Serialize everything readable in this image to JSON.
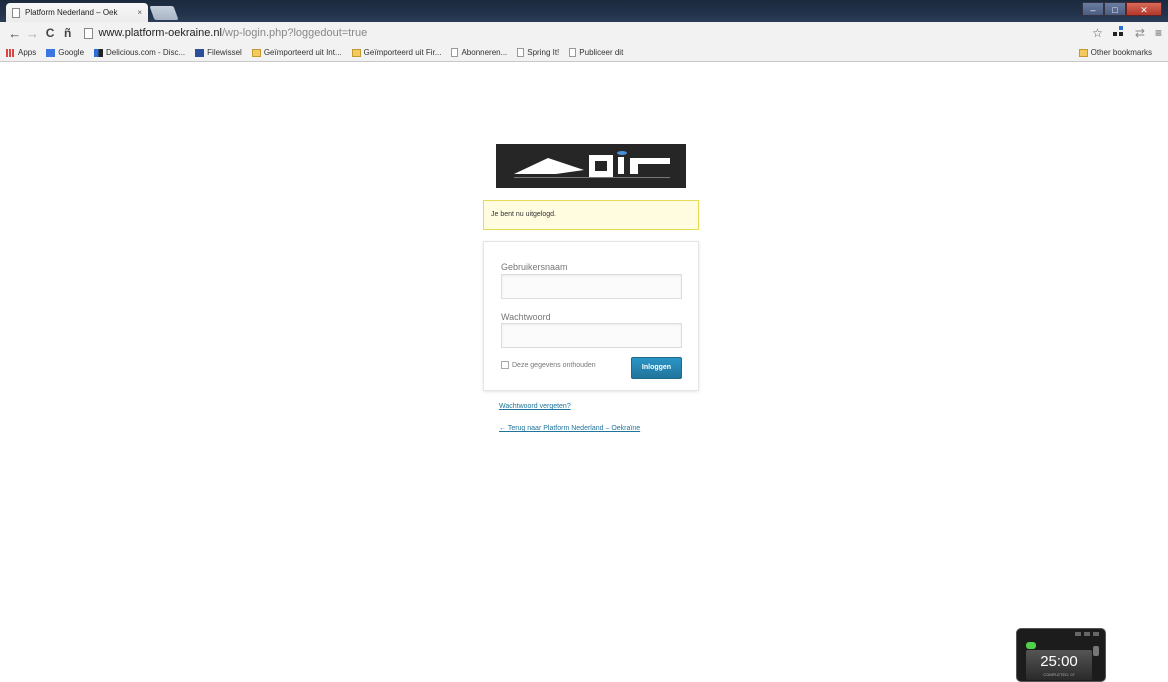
{
  "browser": {
    "tab_title": "Platform Nederland – Oek",
    "tab_close": "×",
    "url_host": "www.platform-oekraine.nl",
    "url_path": "/wp-login.php?loggedout=true",
    "nav": {
      "back": "←",
      "forward": "→",
      "reload": "C",
      "home": "ñ"
    },
    "toolbar_right": {
      "star": "☆",
      "menu": "≡"
    },
    "bookmarks": [
      {
        "label": "Apps",
        "icon": "apps-icon"
      },
      {
        "label": "Google",
        "icon": "google-icon"
      },
      {
        "label": "Delicious.com - Disc...",
        "icon": "delicious-icon"
      },
      {
        "label": "Filewissel",
        "icon": "filewissel-icon"
      },
      {
        "label": "Geïmporteerd uit Int...",
        "icon": "folder-icon"
      },
      {
        "label": "Geïmporteerd uit Fir...",
        "icon": "folder-icon"
      },
      {
        "label": "Abonneren...",
        "icon": "page-icon"
      },
      {
        "label": "Spring It!",
        "icon": "page-icon"
      },
      {
        "label": "Publiceer dit",
        "icon": "page-icon"
      }
    ],
    "other_bookmarks": "Other bookmarks"
  },
  "login": {
    "notice": "Je bent nu uitgelogd.",
    "username_label": "Gebruikersnaam",
    "username_value": "",
    "password_label": "Wachtwoord",
    "password_value": "",
    "remember_label": "Deze gegevens onthouden",
    "submit_label": "Inloggen",
    "lost_password": "Wachtwoord vergeten?",
    "back_link": "← Terug naar Platform Nederland – Oekraïne"
  },
  "timer": {
    "time": "25:00",
    "status": "COMPLETED: 07"
  },
  "colors": {
    "accent": "#21759b",
    "notice_bg": "#fffce0",
    "notice_border": "#e6db55"
  }
}
